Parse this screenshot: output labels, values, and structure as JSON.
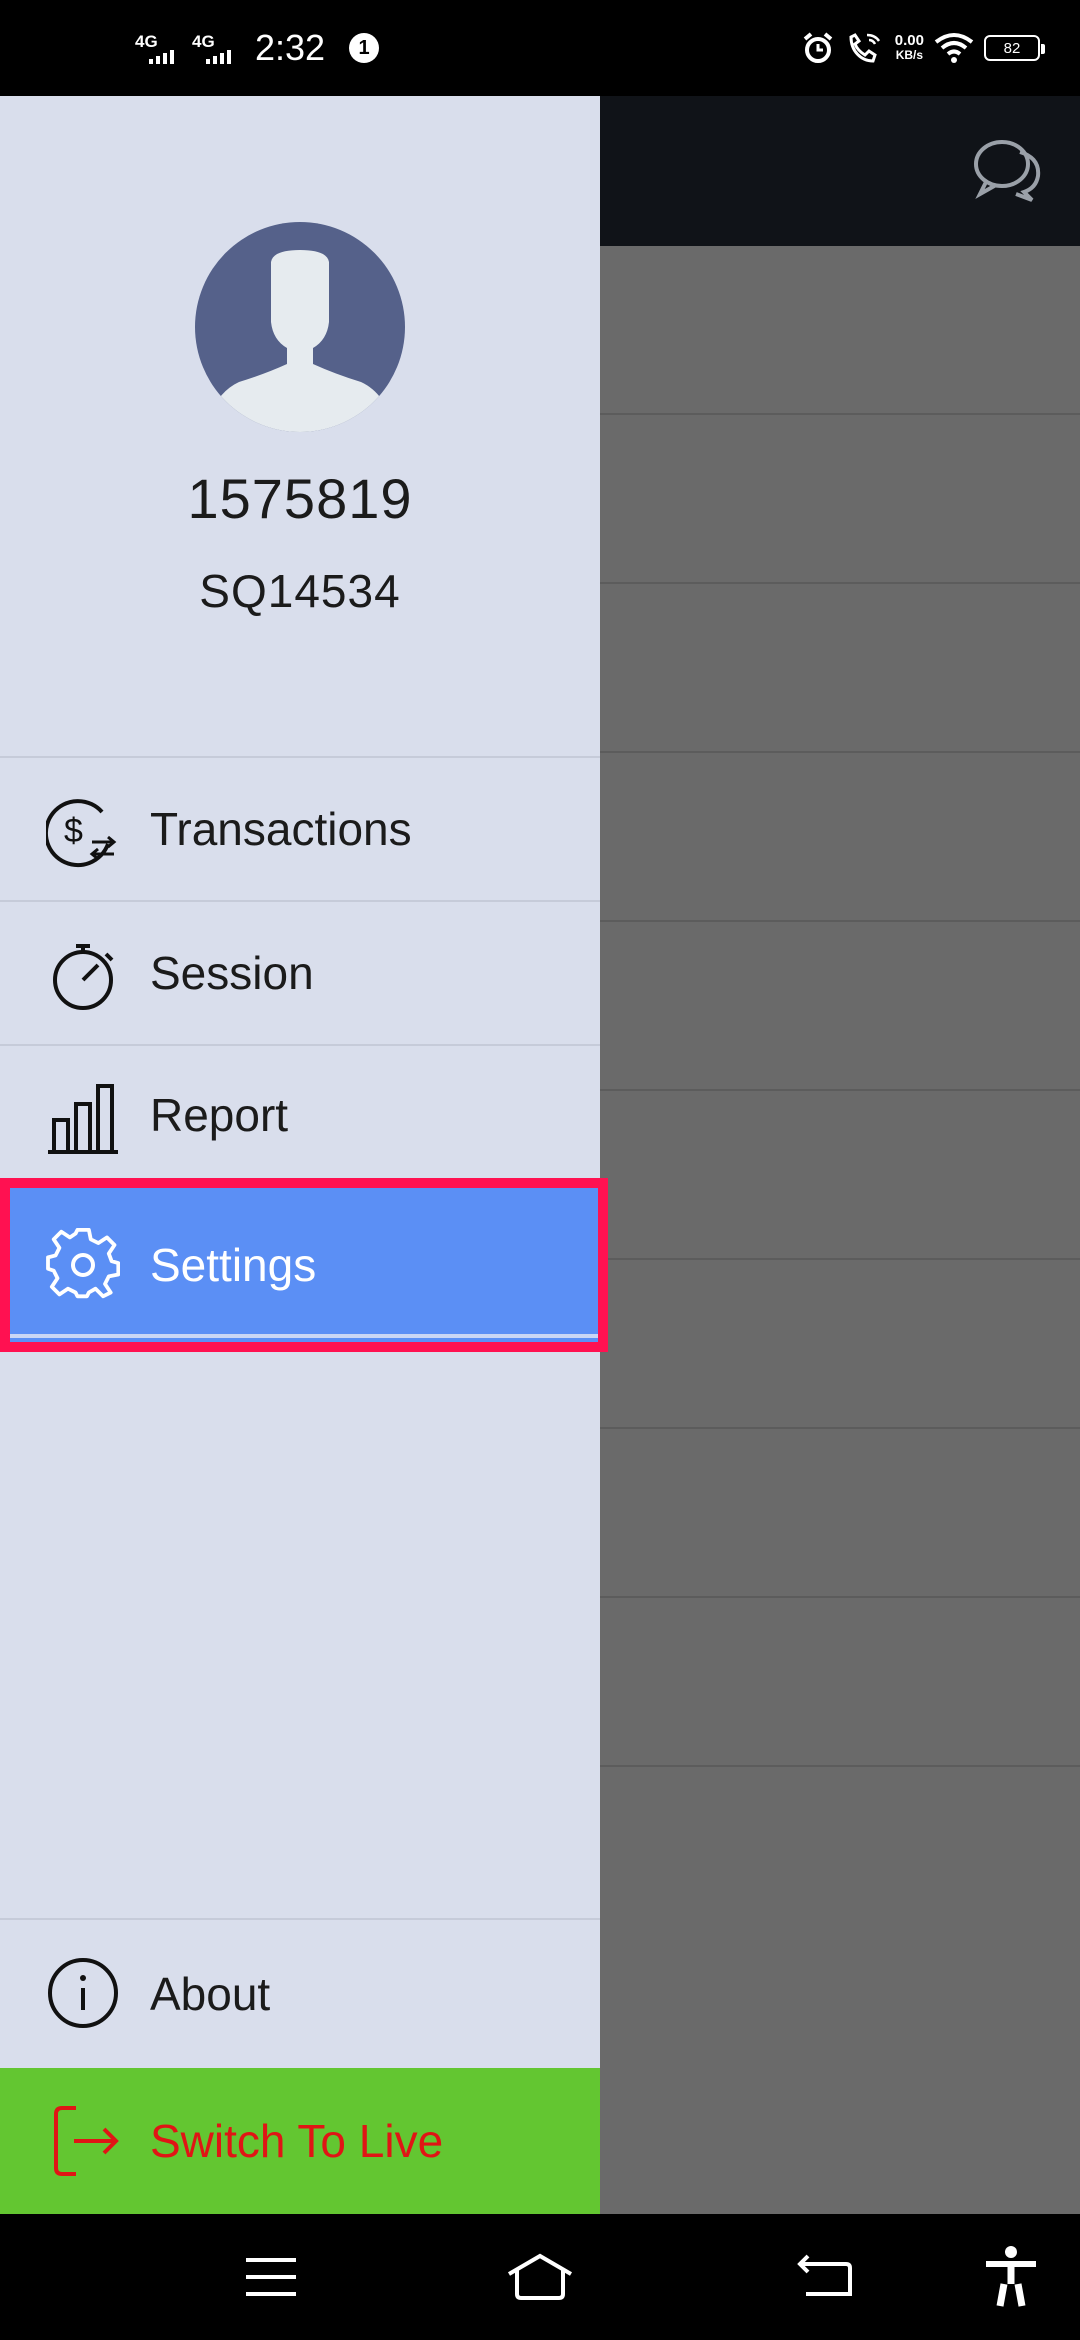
{
  "status_bar": {
    "network1": "4G",
    "network2": "4G",
    "time": "2:32",
    "notification_count": "1",
    "speed_value": "0.00",
    "speed_unit": "KB/s",
    "battery": "82"
  },
  "profile": {
    "user_id": "1575819",
    "code": "SQ14534"
  },
  "menu": {
    "items": [
      {
        "label": "Transactions",
        "icon": "dollar-exchange-icon"
      },
      {
        "label": "Session",
        "icon": "stopwatch-icon"
      },
      {
        "label": "Report",
        "icon": "bar-chart-icon"
      },
      {
        "label": "Settings",
        "icon": "gear-icon",
        "selected": true
      }
    ],
    "about": {
      "label": "About",
      "icon": "info-icon"
    },
    "switch_live": {
      "label": "Switch To Live",
      "icon": "exit-icon"
    }
  },
  "colors": {
    "drawer_bg": "#d9deec",
    "selected_bg": "#5b8ff5",
    "highlight_border": "#ff1151",
    "switch_bg": "#63c631",
    "switch_text": "#e01515",
    "avatar_bg": "#55618a"
  }
}
